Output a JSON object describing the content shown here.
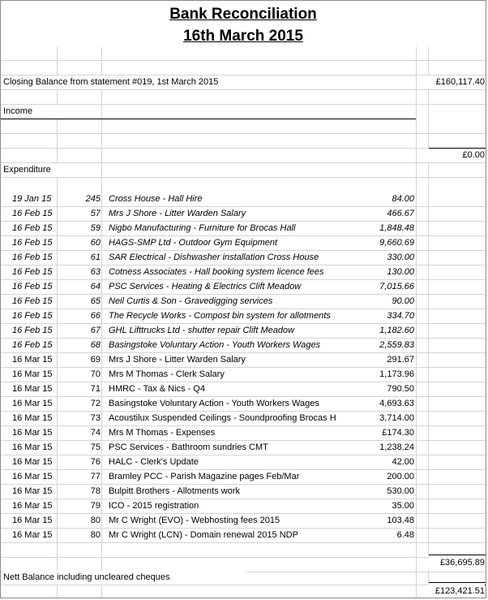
{
  "title_line1": "Bank Reconciliation",
  "title_line2": "16th March 2015",
  "closing_label": "Closing Balance from statement #019, 1st March 2015",
  "closing_value": "£160,117.40",
  "income_label": "Income",
  "income_total": "£0.00",
  "expenditure_label": "Expenditure",
  "expenditure_total": "£36,695.89",
  "nett_label": "Nett Balance including uncleared cheques",
  "nett_value": "£123,421.51",
  "expenditure": [
    {
      "date": "19 Jan 15",
      "no": "245",
      "desc": "Cross House - Hall Hire",
      "amount": "84.00",
      "italic": true
    },
    {
      "date": "16 Feb 15",
      "no": "57",
      "desc": "Mrs J Shore - Litter Warden Salary",
      "amount": "466.67",
      "italic": true
    },
    {
      "date": "16 Feb 15",
      "no": "59",
      "desc": "Nigbo Manufacturing - Furniture for Brocas Hall",
      "amount": "1,848.48",
      "italic": true
    },
    {
      "date": "16 Feb 15",
      "no": "60",
      "desc": "HAGS-SMP Ltd - Outdoor Gym Equipment",
      "amount": "9,660.69",
      "italic": true
    },
    {
      "date": "16 Feb 15",
      "no": "61",
      "desc": "SAR Electrical - Dishwasher installation Cross House",
      "amount": "330.00",
      "italic": true
    },
    {
      "date": "16 Feb 15",
      "no": "63",
      "desc": "Cotness Associates - Hall booking system licence fees",
      "amount": "130.00",
      "italic": true
    },
    {
      "date": "16 Feb 15",
      "no": "64",
      "desc": "PSC Services - Heating & Electrics Clift Meadow",
      "amount": "7,015.66",
      "italic": true
    },
    {
      "date": "16 Feb 15",
      "no": "65",
      "desc": "Neil Curtis & Son - Gravedigging services",
      "amount": "90.00",
      "italic": true
    },
    {
      "date": "16 Feb 15",
      "no": "66",
      "desc": "The Recycle Works - Compost bin system for allotments",
      "amount": "334.70",
      "italic": true
    },
    {
      "date": "16 Feb 15",
      "no": "67",
      "desc": "GHL Lifttrucks Ltd - shutter repair Clift Meadow",
      "amount": "1,182.60",
      "italic": true
    },
    {
      "date": "16 Feb 15",
      "no": "68",
      "desc": "Basingstoke Voluntary Action - Youth Workers Wages",
      "amount": "2,559.83",
      "italic": true
    },
    {
      "date": "16 Mar 15",
      "no": "69",
      "desc": "Mrs J Shore - Litter Warden Salary",
      "amount": "291.67",
      "italic": false
    },
    {
      "date": "16 Mar 15",
      "no": "70",
      "desc": "Mrs M Thomas - Clerk Salary",
      "amount": "1,173.96",
      "italic": false
    },
    {
      "date": "16 Mar 15",
      "no": "71",
      "desc": "HMRC - Tax & Nics - Q4",
      "amount": "790.50",
      "italic": false
    },
    {
      "date": "16 Mar 15",
      "no": "72",
      "desc": "Basingstoke Voluntary Action - Youth Workers Wages",
      "amount": "4,693.63",
      "italic": false
    },
    {
      "date": "16 Mar 15",
      "no": "73",
      "desc": "Acoustilux Suspended Ceilings - Soundproofing Brocas H",
      "amount": "3,714.00",
      "italic": false
    },
    {
      "date": "16 Mar 15",
      "no": "74",
      "desc": "Mrs M Thomas - Expenses",
      "amount": "£174.30",
      "italic": false
    },
    {
      "date": "16 Mar 15",
      "no": "75",
      "desc": "PSC Services - Bathroom sundries CMT",
      "amount": "1,238.24",
      "italic": false
    },
    {
      "date": "16 Mar 15",
      "no": "76",
      "desc": "HALC - Clerk's Update",
      "amount": "42.00",
      "italic": false
    },
    {
      "date": "16 Mar 15",
      "no": "77",
      "desc": "Bramley PCC - Parish Magazine pages Feb/Mar",
      "amount": "200.00",
      "italic": false
    },
    {
      "date": "16 Mar 15",
      "no": "78",
      "desc": "Bulpitt Brothers - Allotments work",
      "amount": "530.00",
      "italic": false
    },
    {
      "date": "16 Mar 15",
      "no": "79",
      "desc": "ICO - 2015 registration",
      "amount": "35.00",
      "italic": false
    },
    {
      "date": "16 Mar 15",
      "no": "80",
      "desc": "Mr C Wright (EVO) - Webhosting fees 2015",
      "amount": "103.48",
      "italic": false
    },
    {
      "date": "16 Mar 15",
      "no": "80",
      "desc": "Mr C Wright (LCN) - Domain renewal 2015 NDP",
      "amount": "6.48",
      "italic": false
    }
  ]
}
